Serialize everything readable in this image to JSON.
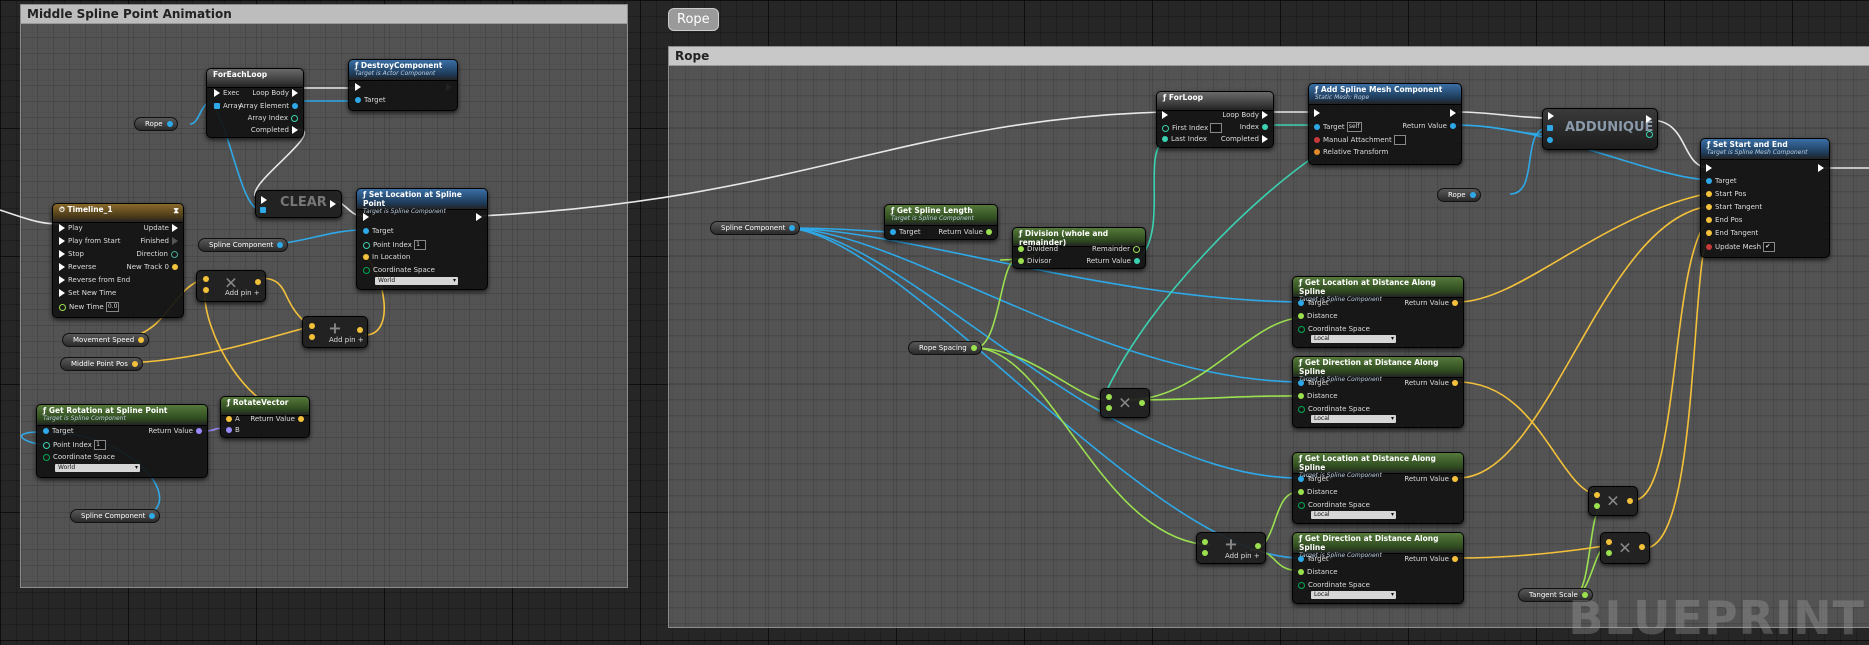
{
  "comments": {
    "left_title": "Middle Spline Point Animation",
    "right_title": "Rope",
    "bubble": "Rope"
  },
  "nodes": {
    "foreachloop": {
      "title": "ForEachLoop",
      "exec": "Exec",
      "array": "Array",
      "loop_body": "Loop Body",
      "array_element": "Array Element",
      "array_index": "Array Index",
      "completed": "Completed"
    },
    "destroy": {
      "title": "DestroyComponent",
      "subtitle": "Target is Actor Component",
      "target": "Target"
    },
    "timeline": {
      "title": "Timeline_1",
      "pins_left": [
        "Play",
        "Play from Start",
        "Stop",
        "Reverse",
        "Reverse from End",
        "Set New Time",
        "New Time"
      ],
      "new_time_value": "0.0",
      "pins_right": [
        "Update",
        "Finished",
        "Direction",
        "New Track 0"
      ]
    },
    "clear": {
      "label": "CLEAR"
    },
    "setloc": {
      "title": "Set Location at Spline Point",
      "subtitle": "Target is Spline Component",
      "target": "Target",
      "point_index": "Point Index",
      "point_index_value": "1",
      "in_location": "In Location",
      "coord_space": "Coordinate Space",
      "coord_value": "World"
    },
    "addpin_small1": {
      "label": "Add pin"
    },
    "addpin_small2": {
      "label": "Add pin"
    },
    "getrot": {
      "title": "Get Rotation at Spline Point",
      "subtitle": "Target is Spline Component",
      "target": "Target",
      "point_index": "Point Index",
      "point_index_value": "1",
      "coord_space": "Coordinate Space",
      "coord_value": "World",
      "return_value": "Return Value"
    },
    "rotatevec": {
      "title": "RotateVector",
      "a": "A",
      "b": "B",
      "return_value": "Return Value"
    },
    "forloop": {
      "title": "ForLoop",
      "first_index": "First Index",
      "last_index": "Last Index",
      "loop_body": "Loop Body",
      "index": "Index",
      "completed": "Completed"
    },
    "addmesh": {
      "title": "Add Spline Mesh Component",
      "subtitle": "Static Mesh: Rope",
      "target": "Target",
      "target_value": "self",
      "manual": "Manual Attachment",
      "relative": "Relative Transform",
      "return_value": "Return Value"
    },
    "addunique": {
      "label": "ADDUNIQUE"
    },
    "setstartend": {
      "title": "Set Start and End",
      "subtitle": "Target is Spline Mesh Component",
      "pins": [
        "Target",
        "Start Pos",
        "Start Tangent",
        "End Pos",
        "End Tangent",
        "Update Mesh"
      ]
    },
    "getlength": {
      "title": "Get Spline Length",
      "subtitle": "Target is Spline Component",
      "target": "Target",
      "return_value": "Return Value"
    },
    "division": {
      "title": "Division (whole and remainder)",
      "dividend": "Dividend",
      "divisor": "Divisor",
      "remainder": "Remainder",
      "return_value": "Return Value"
    },
    "getloc1": {
      "title": "Get Location at Distance Along Spline",
      "subtitle": "Target is Spline Component",
      "target": "Target",
      "distance": "Distance",
      "coord_space": "Coordinate Space",
      "coord_value": "Local",
      "return_value": "Return Value"
    },
    "getdir1": {
      "title": "Get Direction at Distance Along Spline",
      "subtitle": "Target is Spline Component",
      "target": "Target",
      "distance": "Distance",
      "coord_space": "Coordinate Space",
      "coord_value": "Local",
      "return_value": "Return Value"
    },
    "getloc2": {
      "title": "Get Location at Distance Along Spline",
      "subtitle": "Target is Spline Component",
      "target": "Target",
      "distance": "Distance",
      "coord_space": "Coordinate Space",
      "coord_value": "Local",
      "return_value": "Return Value"
    },
    "getdir2": {
      "title": "Get Direction at Distance Along Spline",
      "subtitle": "Target is Spline Component",
      "target": "Target",
      "distance": "Distance",
      "coord_space": "Coordinate Space",
      "coord_value": "Local",
      "return_value": "Return Value"
    },
    "addpin_big": {
      "label": "Add pin"
    }
  },
  "variables": {
    "rope_left": "Rope",
    "spline_comp_1": "Spline Component",
    "movement_speed": "Movement Speed",
    "middle_point_pos": "Middle Point Pos",
    "spline_comp_2": "Spline Component",
    "spline_comp_right": "Spline Component",
    "rope_spacing": "Rope Spacing",
    "rope_right": "Rope",
    "tangent_scale": "Tangent Scale"
  },
  "watermark": "BLUEPRINT"
}
